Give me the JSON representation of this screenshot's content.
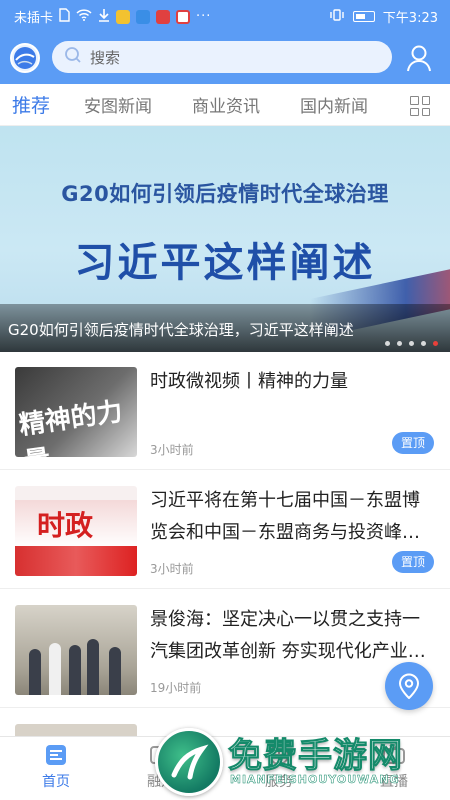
{
  "status_bar": {
    "carrier": "未插卡",
    "time": "下午3:23",
    "icons": [
      "sim-card-icon",
      "wifi-icon",
      "download-icon",
      "app-icon",
      "app-icon",
      "app-icon",
      "app-icon",
      "more-icon",
      "vibrate-icon",
      "battery-icon"
    ]
  },
  "header": {
    "logo": "app-logo-icon",
    "search_placeholder": "搜索",
    "user_icon": "user-icon"
  },
  "tabs": [
    {
      "label": "推荐",
      "active": true
    },
    {
      "label": "安图新闻",
      "active": false
    },
    {
      "label": "商业资讯",
      "active": false
    },
    {
      "label": "国内新闻",
      "active": false
    }
  ],
  "tabs_more_icon": "grid-icon",
  "banner": {
    "headline_line1": "G20如何引领后疫情时代全球治理",
    "headline_line2": "习近平这样阐述",
    "caption": "G20如何引领后疫情时代全球治理，习近平这样阐述",
    "dot_count": 5,
    "active_dot": 5
  },
  "news": [
    {
      "title": "时政微视频丨精神的力量",
      "thumb_text": "精神的力量",
      "time": "3小时前",
      "pin_label": "置顶"
    },
    {
      "title": "习近平将在第十七届中国－东盟博览会和中国－东盟商务与投资峰会开幕式上致辞",
      "thumb_text": "时政",
      "time": "3小时前",
      "pin_label": "置顶"
    },
    {
      "title": "景俊海：坚定决心一以贯之支持一汽集团改革创新 夯实现代化产业体系",
      "thumb_text": "",
      "time": "19小时前",
      "pin_label": ""
    }
  ],
  "fab_icon": "location-icon",
  "bottom_nav": [
    {
      "label": "首页",
      "icon": "home-icon",
      "active": true
    },
    {
      "label": "融媒",
      "icon": "media-icon",
      "active": false
    },
    {
      "label": "服务",
      "icon": "service-icon",
      "active": false
    },
    {
      "label": "直播",
      "icon": "live-icon",
      "active": false
    }
  ],
  "watermark": {
    "title": "免费手游网",
    "subtitle": "MIANFEISHOUYOUWANG"
  },
  "colors": {
    "primary": "#5b9cf5",
    "tab_active": "#3d7be8",
    "dot_active": "#e8403a"
  }
}
